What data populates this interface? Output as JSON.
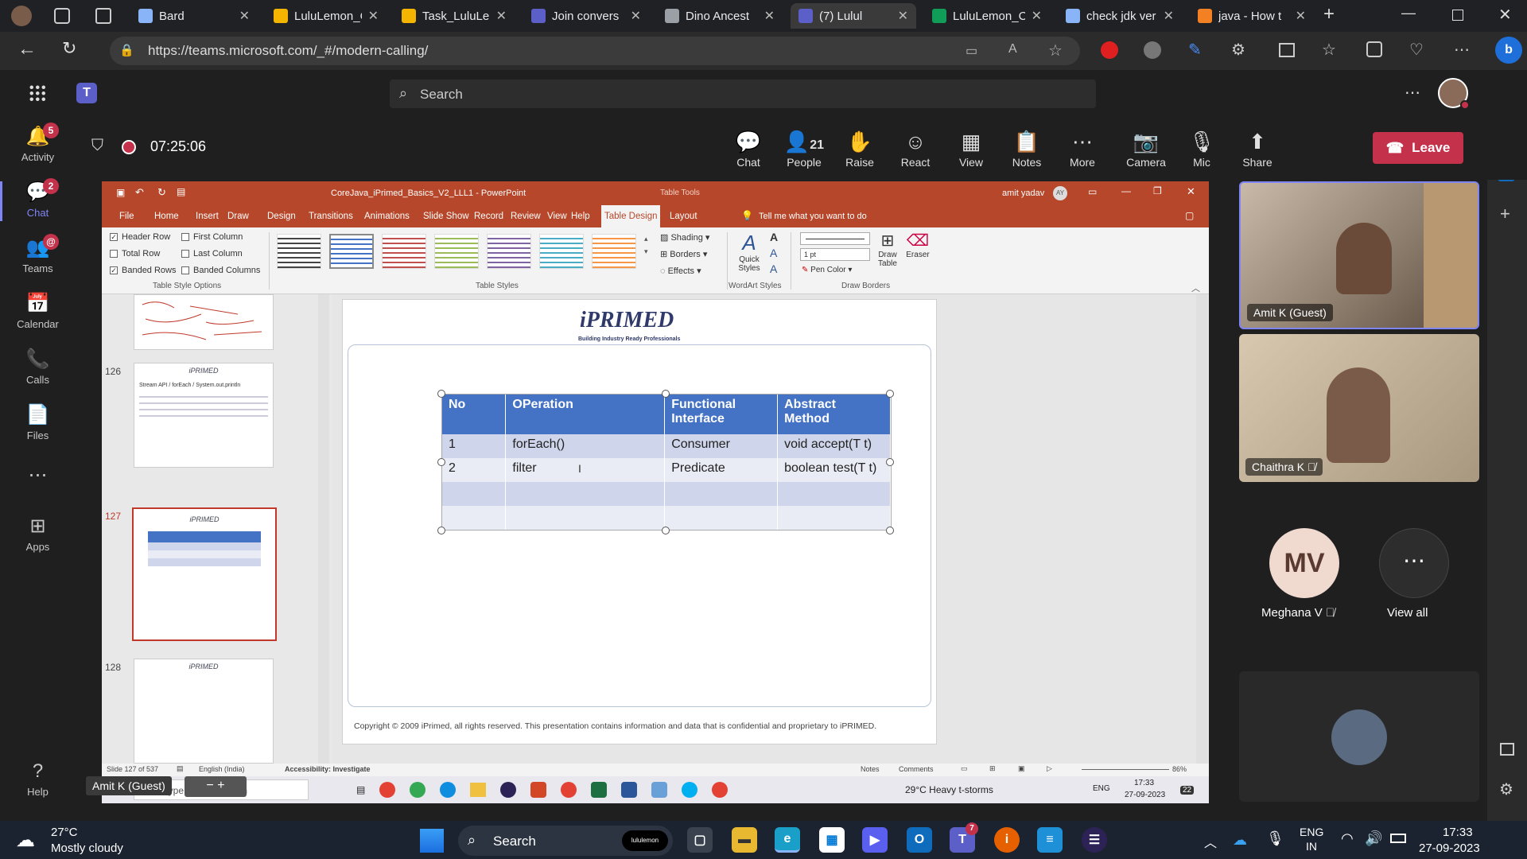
{
  "browser": {
    "tabs": [
      {
        "label": "Bard",
        "color": "#8ab4f8"
      },
      {
        "label": "LuluLemon_C",
        "color": "#f4b400"
      },
      {
        "label": "Task_LuluLem",
        "color": "#f4b400"
      },
      {
        "label": "Join convers",
        "color": "#5b5fc7"
      },
      {
        "label": "Dino Ancest",
        "color": "#9aa0a6"
      },
      {
        "label": "(7) Lulul",
        "color": "#5b5fc7",
        "active": true
      },
      {
        "label": "LuluLemon_C",
        "color": "#0f9d58"
      },
      {
        "label": "check jdk ver",
        "color": "#8ab4f8"
      },
      {
        "label": "java - How t",
        "color": "#f48024"
      }
    ],
    "url": "https://teams.microsoft.com/_#/modern-calling/"
  },
  "teams": {
    "search_placeholder": "Search",
    "rail": [
      {
        "label": "Activity",
        "icon": "bell-icon",
        "badge": "5"
      },
      {
        "label": "Chat",
        "icon": "chat-icon",
        "badge": "2"
      },
      {
        "label": "Teams",
        "icon": "teams-icon",
        "badge": "@"
      },
      {
        "label": "Calendar",
        "icon": "calendar-icon"
      },
      {
        "label": "Calls",
        "icon": "phone-icon"
      },
      {
        "label": "Files",
        "icon": "file-icon"
      },
      {
        "label": "...",
        "icon": "more-icon"
      },
      {
        "label": "Apps",
        "icon": "apps-icon"
      },
      {
        "label": "Help",
        "icon": "help-icon"
      }
    ],
    "call": {
      "timer": "07:25:06",
      "buttons": [
        {
          "label": "Chat",
          "icon": "chat-icon"
        },
        {
          "label": "People",
          "icon": "people-icon",
          "count": "21"
        },
        {
          "label": "Raise",
          "icon": "hand-icon"
        },
        {
          "label": "React",
          "icon": "smile-icon"
        },
        {
          "label": "View",
          "icon": "view-icon"
        },
        {
          "label": "Notes",
          "icon": "notes-icon"
        },
        {
          "label": "More",
          "icon": "more-icon"
        },
        {
          "label": "Camera",
          "icon": "camera-off-icon"
        },
        {
          "label": "Mic",
          "icon": "mic-off-icon"
        },
        {
          "label": "Share",
          "icon": "share-icon"
        }
      ],
      "leave": "Leave"
    },
    "participants": [
      {
        "name": "Amit K (Guest)"
      },
      {
        "name": "Chaithra K"
      },
      {
        "name": "Meghana V",
        "initials": "MV"
      },
      {
        "name": "View all"
      }
    ],
    "presenter_label": "Amit K (Guest)"
  },
  "ppt": {
    "title": "CoreJava_iPrimed_Basics_V2_LLL1  -  PowerPoint",
    "context": "Table Tools",
    "user": "amit yadav",
    "user_initials": "AY",
    "menu": [
      "File",
      "Home",
      "Insert",
      "Draw",
      "Design",
      "Transitions",
      "Animations",
      "Slide Show",
      "Record",
      "Review",
      "View",
      "Help",
      "Table Design",
      "Layout"
    ],
    "tell_me": "Tell me what you want to do",
    "style_options": [
      {
        "label": "Header Row",
        "checked": true
      },
      {
        "label": "First Column",
        "checked": false
      },
      {
        "label": "Total Row",
        "checked": false
      },
      {
        "label": "Last Column",
        "checked": false
      },
      {
        "label": "Banded Rows",
        "checked": true
      },
      {
        "label": "Banded Columns",
        "checked": false
      }
    ],
    "groups": {
      "style_options": "Table Style Options",
      "table_styles": "Table Styles",
      "wordart": "WordArt Styles",
      "borders": "Draw Borders"
    },
    "shading": "Shading",
    "borders_btn": "Borders",
    "effects": "Effects",
    "quick_styles": "Quick Styles",
    "pt": "1 pt",
    "pen_color": "Pen Color",
    "draw_table": "Draw Table",
    "eraser": "Eraser",
    "thumbs": [
      {
        "num": ""
      },
      {
        "num": "126",
        "text": "Stream API / forEach / System.out.println"
      },
      {
        "num": "127"
      },
      {
        "num": "128"
      }
    ],
    "slide": {
      "logo": "iPRIMED",
      "logo_tag": "Building Industry Ready Professionals",
      "table": {
        "header": [
          "No",
          "OPeration",
          "Functional Interface",
          "Abstract Method"
        ],
        "rows": [
          [
            "1",
            "forEach()",
            "Consumer",
            "void accept(T t)"
          ],
          [
            "2",
            "filter",
            "Predicate",
            "boolean test(T t)"
          ],
          [
            "",
            "",
            "",
            ""
          ],
          [
            "",
            "",
            "",
            ""
          ]
        ]
      },
      "footer": "Copyright © 2009 iPrimed, all rights reserved. This presentation contains information  and data  that is confidential and proprietary to iPRIMED."
    },
    "status": {
      "slide": "Slide 127 of 537",
      "lang": "English (India)",
      "access": "Accessibility: Investigate",
      "notes": "Notes",
      "comments": "Comments",
      "zoom": "86%"
    },
    "inner_taskbar": {
      "search": "Type here to search",
      "weather": "29°C  Heavy t-storms",
      "lang": "ENG",
      "time": "17:33",
      "date": "27-09-2023",
      "notif": "22"
    }
  },
  "win": {
    "weather_temp": "27°C",
    "weather_desc": "Mostly cloudy",
    "search": "Search",
    "search_badge": "lululemon",
    "lang": "ENG",
    "region": "IN",
    "time": "17:33",
    "date": "27-09-2023"
  }
}
